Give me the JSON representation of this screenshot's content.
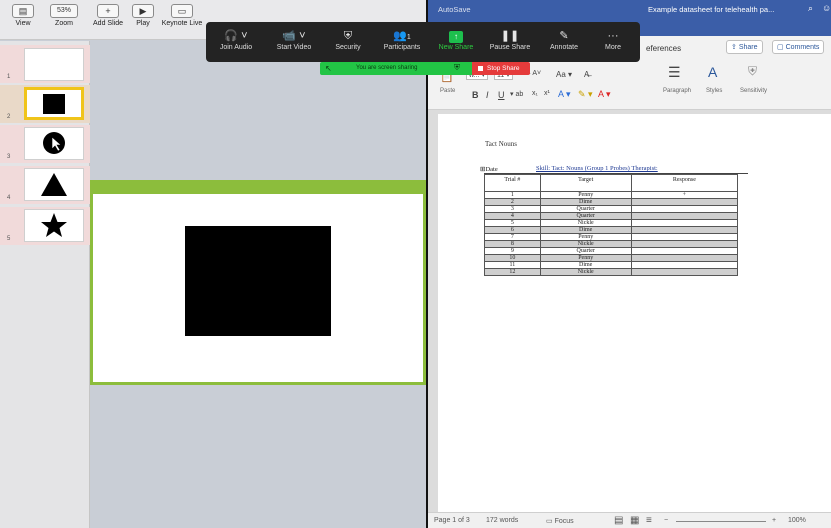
{
  "keynote": {
    "toolbar": {
      "view": "View",
      "zoom_value": "53%",
      "zoom": "Zoom",
      "add_slide": "Add Slide",
      "play": "Play",
      "keynote_live": "Keynote Live"
    },
    "slides": [
      {
        "number": "1"
      },
      {
        "number": "2"
      },
      {
        "number": "3"
      },
      {
        "number": "4"
      },
      {
        "number": "5"
      }
    ]
  },
  "zoom_controls": {
    "join_audio": "Join Audio",
    "start_video": "Start Video",
    "security": "Security",
    "participants": "Participants",
    "participants_count": "1",
    "new_share": "New Share",
    "pause_share": "Pause Share",
    "annotate": "Annotate",
    "more": "More",
    "sharing_notice": "You are screen sharing",
    "stop_share": "Stop Share"
  },
  "word": {
    "autosave": "AutoSave",
    "doc_title": "Example datasheet for telehealth pa...",
    "ribbon": {
      "references": "eferences",
      "share": "Share",
      "comments": "Comments",
      "font_size": "11",
      "paste": "Paste",
      "paragraph": "Paragraph",
      "styles": "Styles",
      "sensitivity": "Sensitivity"
    },
    "document": {
      "heading": "Tact Nouns",
      "date_label": "Date",
      "skill_line": "Skill:   Tact: Nouns (Group 1 Probes)   Therapist:",
      "table": {
        "headers": [
          "Trial #",
          "Target",
          "Response"
        ],
        "rows": [
          {
            "trial": "1",
            "target": "Penny",
            "response": "+"
          },
          {
            "trial": "2",
            "target": "Dime",
            "response": ""
          },
          {
            "trial": "3",
            "target": "Quarter",
            "response": ""
          },
          {
            "trial": "4",
            "target": "Quarter",
            "response": ""
          },
          {
            "trial": "5",
            "target": "Nickle",
            "response": ""
          },
          {
            "trial": "6",
            "target": "Dime",
            "response": ""
          },
          {
            "trial": "7",
            "target": "Penny",
            "response": ""
          },
          {
            "trial": "8",
            "target": "Nickle",
            "response": ""
          },
          {
            "trial": "9",
            "target": "Quarter",
            "response": ""
          },
          {
            "trial": "10",
            "target": "Penny",
            "response": ""
          },
          {
            "trial": "11",
            "target": "Dime",
            "response": ""
          },
          {
            "trial": "12",
            "target": "Nickle",
            "response": ""
          }
        ]
      }
    },
    "status": {
      "page": "Page 1 of 3",
      "words": "172 words",
      "focus": "Focus",
      "zoom_pct": "100%"
    }
  }
}
